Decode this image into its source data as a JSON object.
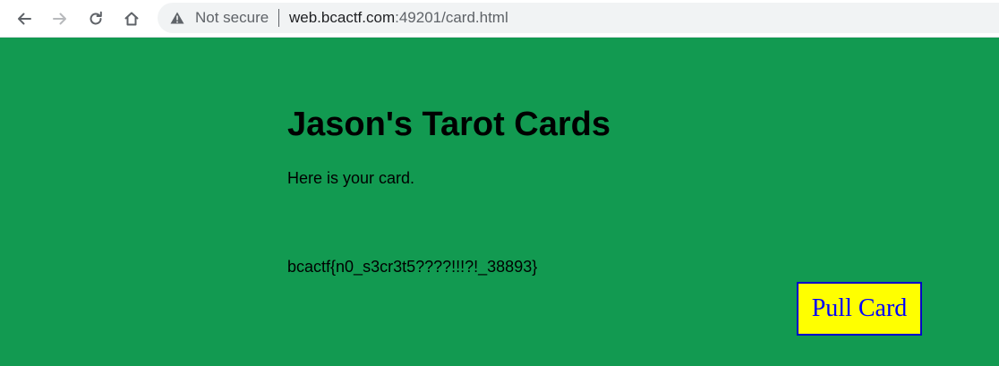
{
  "browser": {
    "security_label": "Not secure",
    "url_host": "web.bcactf.com",
    "url_rest": ":49201/card.html",
    "icons": {
      "back": "back-arrow-icon",
      "forward": "forward-arrow-icon",
      "reload": "reload-icon",
      "home": "home-icon",
      "warning": "warning-triangle-icon"
    }
  },
  "page": {
    "background_color": "#129a51",
    "title": "Jason's Tarot Cards",
    "intro": "Here is your card.",
    "card_text": "bcactf{n0_s3cr3t5????!!!?!_38893}",
    "pull_button_label": "Pull Card",
    "pull_button_bg": "#ffff00",
    "pull_button_color": "#0000ff"
  }
}
